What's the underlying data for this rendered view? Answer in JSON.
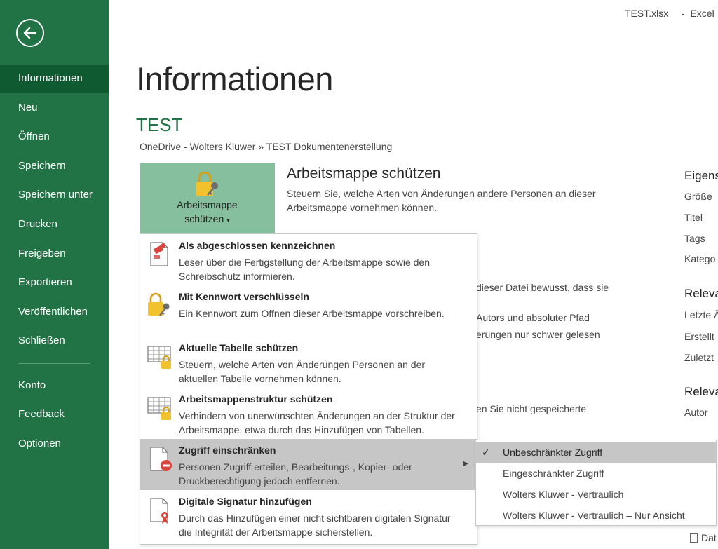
{
  "window": {
    "file_name": "TEST.xlsx",
    "separator": "-",
    "app_name": "Excel"
  },
  "sidebar": {
    "items": [
      {
        "label": "Informationen",
        "active": true
      },
      {
        "label": "Neu"
      },
      {
        "label": "Öffnen"
      },
      {
        "label": "Speichern"
      },
      {
        "label": "Speichern unter"
      },
      {
        "label": "Drucken"
      },
      {
        "label": "Freigeben"
      },
      {
        "label": "Exportieren"
      },
      {
        "label": "Veröffentlichen"
      },
      {
        "label": "Schließen"
      }
    ],
    "footer_items": [
      {
        "label": "Konto"
      },
      {
        "label": "Feedback"
      },
      {
        "label": "Optionen"
      }
    ]
  },
  "main": {
    "page_title": "Informationen",
    "doc_name": "TEST",
    "breadcrumb": "OneDrive - Wolters Kluwer » TEST Dokumentenerstellung",
    "protect_button": {
      "line1": "Arbeitsmappe",
      "line2": "schützen",
      "caret": "▾"
    },
    "section_title": "Arbeitsmappe schützen",
    "section_desc": "Steuern Sie, welche Arten von Änderungen andere Personen an dieser Arbeitsmappe vornehmen können.",
    "background_fragments": [
      "dieser Datei bewusst, dass sie",
      "Autors und absoluter Pfad",
      "erungen nur schwer gelesen",
      "en Sie nicht gespeicherte"
    ],
    "properties_fragments": {
      "head1": "Eigens",
      "items1": [
        "Größe",
        "Titel",
        "Tags",
        "Katego"
      ],
      "head2": "Releva",
      "items2": [
        "Letzte Ä",
        "Erstellt",
        "Zuletzt"
      ],
      "head3": "Releva",
      "items3": [
        "Autor"
      ],
      "bottom": "Dat"
    }
  },
  "menu": {
    "items": [
      {
        "title": "Als abgeschlossen kennzeichnen",
        "desc": "Leser über die Fertigstellung der Arbeitsmappe sowie den Schreibschutz informieren.",
        "icon": "mark-final-icon"
      },
      {
        "title": "Mit Kennwort verschlüsseln",
        "desc": "Ein Kennwort zum Öffnen dieser Arbeitsmappe vorschreiben.",
        "icon": "lock-key-icon"
      },
      {
        "title": "Aktuelle Tabelle schützen",
        "desc": "Steuern, welche Arten von Änderungen Personen an der aktuellen Tabelle vornehmen können.",
        "icon": "sheet-lock-icon"
      },
      {
        "title": "Arbeitsmappenstruktur schützen",
        "desc": "Verhindern von unerwünschten Änderungen an der Struktur der Arbeitsmappe, etwa durch das Hinzufügen von Tabellen.",
        "icon": "workbook-lock-icon"
      },
      {
        "title": "Zugriff einschränken",
        "desc": "Personen Zugriff erteilen, Bearbeitungs-, Kopier- oder Druckberechtigung jedoch entfernen.",
        "icon": "restrict-access-icon",
        "highlighted": true,
        "has_submenu": true
      },
      {
        "title": "Digitale Signatur hinzufügen",
        "desc": "Durch das Hinzufügen einer nicht sichtbaren digitalen Signatur die Integrität der Arbeitsmappe sicherstellen.",
        "icon": "signature-icon"
      }
    ],
    "submenu_arrow": "▶"
  },
  "submenu": {
    "check": "✓",
    "items": [
      {
        "label": "Unbeschränkter Zugriff",
        "selected": true
      },
      {
        "label": "Eingeschränkter Zugriff"
      },
      {
        "label": "Wolters Kluwer - Vertraulich"
      },
      {
        "label": "Wolters Kluwer - Vertraulich – Nur Ansicht"
      }
    ]
  },
  "colors": {
    "sidebar": "#217346",
    "sidebar_active": "#0f5a31",
    "accent_green": "#217346",
    "protect_button": "#86bf9e",
    "highlight": "#c6c6c6"
  }
}
